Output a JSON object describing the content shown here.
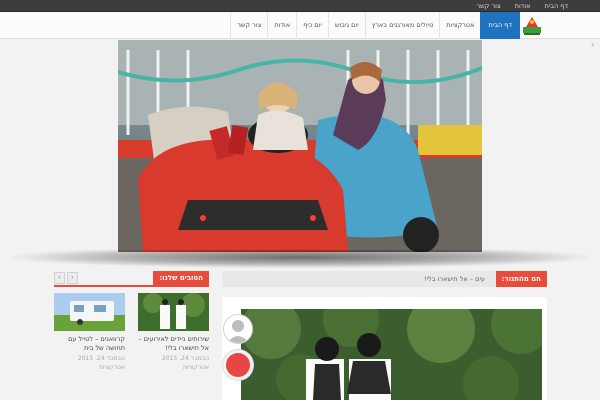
{
  "topbar": {
    "links": [
      "דף הבית",
      "אודות",
      "צור קשר"
    ]
  },
  "nav": {
    "items": [
      {
        "label": "דף הבית",
        "active": true
      },
      {
        "label": "אטרקציות",
        "active": false
      },
      {
        "label": "טיולים מאורגנים בארץ",
        "active": false
      },
      {
        "label": "יום גיבוש",
        "active": false
      },
      {
        "label": "יום כיף",
        "active": false
      },
      {
        "label": "אודות",
        "active": false
      },
      {
        "label": "צור קשר",
        "active": false
      }
    ]
  },
  "ticker": {
    "label": "חם מהתנור:",
    "text": "עים – אל תישארו בלי!"
  },
  "popular": {
    "title": "הטובים שלנו:",
    "prev": "‹",
    "next": "›",
    "posts": [
      {
        "title": "שירותים ניידים לאירועים – אל תישארו בלי!",
        "date": "נובמבר 24, 2015",
        "category": "אטרקציות"
      },
      {
        "title": "קרוואנים – לטייל עם תחושה של בית",
        "date": "נובמבר 24, 2015",
        "category": "אטרקציות"
      }
    ]
  },
  "colors": {
    "accent": "#e74c3c",
    "nav_active": "#1e73be",
    "topbar": "#3d3d3d"
  }
}
